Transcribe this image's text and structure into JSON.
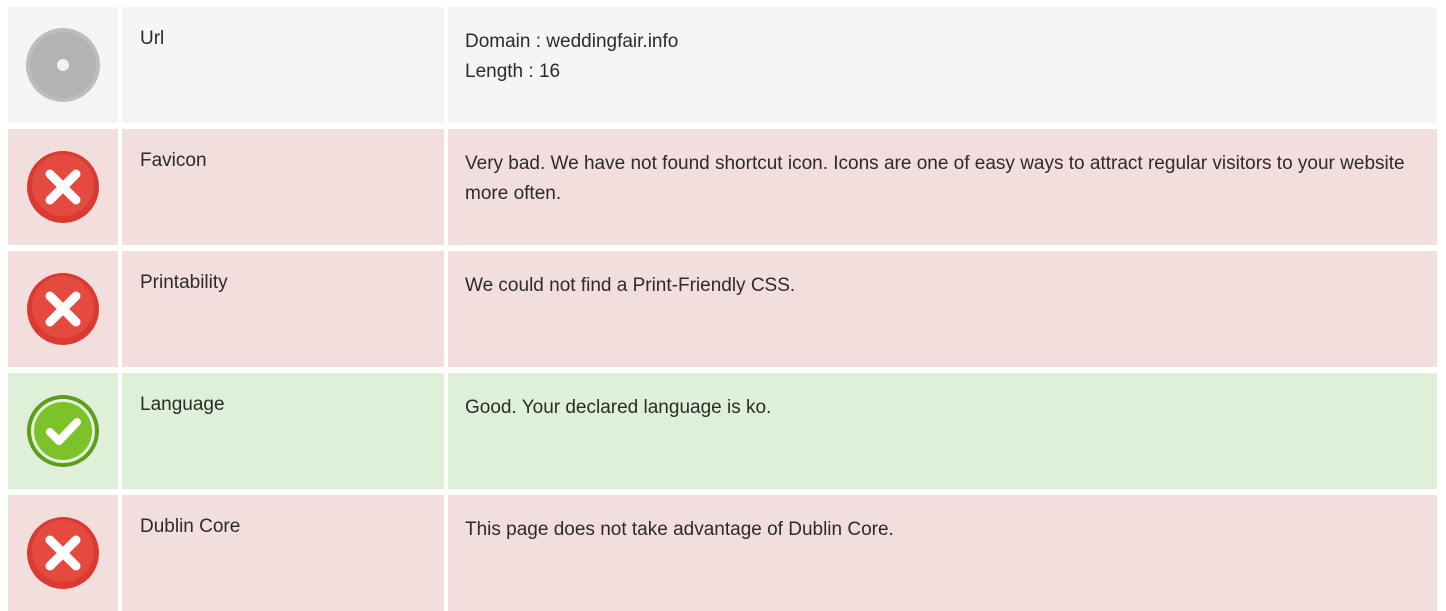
{
  "rows": [
    {
      "status": "neutral",
      "icon": "disc-icon",
      "label": "Url",
      "lines": [
        "Domain : weddingfair.info",
        "Length : 16"
      ]
    },
    {
      "status": "error",
      "icon": "cross-icon",
      "label": "Favicon",
      "lines": [
        "Very bad. We have not found shortcut icon. Icons are one of easy ways to attract regular visitors to your website more often."
      ]
    },
    {
      "status": "error",
      "icon": "cross-icon",
      "label": "Printability",
      "lines": [
        "We could not find a Print-Friendly CSS."
      ]
    },
    {
      "status": "ok",
      "icon": "check-icon",
      "label": "Language",
      "lines": [
        "Good. Your declared language is ko."
      ]
    },
    {
      "status": "error",
      "icon": "cross-icon",
      "label": "Dublin Core",
      "lines": [
        "This page does not take advantage of Dublin Core."
      ]
    }
  ],
  "colors": {
    "neutral_bg": "#f5f5f5",
    "error_bg": "#f3dede",
    "ok_bg": "#dff0d8",
    "error_icon": "#e2443b",
    "ok_icon": "#7cc22a",
    "neutral_icon": "#b9b9b9"
  }
}
